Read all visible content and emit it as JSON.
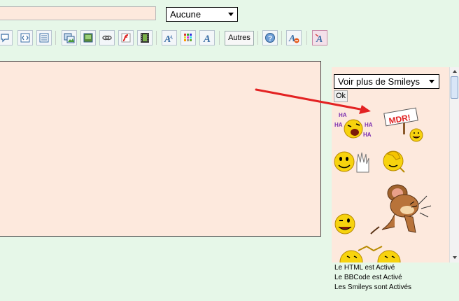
{
  "form": {
    "subject_value": "",
    "format_select": "Aucune"
  },
  "toolbar": {
    "autres_label": "Autres",
    "buttons": [
      "quote-icon",
      "code-icon",
      "list-icon",
      "image-icon",
      "picture-icon",
      "link-icon",
      "flash-icon",
      "video-icon",
      "font-size-icon",
      "color-icon",
      "font-icon",
      "help-icon",
      "clear-format-icon",
      "preview-icon"
    ]
  },
  "editor": {
    "content": ""
  },
  "smileys": {
    "select_label": "Voir plus de Smileys",
    "ok_label": "Ok",
    "sign_text": "MDR!",
    "haha_text": "HA"
  },
  "status": {
    "html": "Le HTML est Activé",
    "bbcode": "Le BBCode est Activé",
    "smileys": "Les Smileys sont Activés"
  },
  "colors": {
    "background": "#e6f7e8",
    "editor_bg": "#fde9dd",
    "arrow": "#e32222"
  }
}
